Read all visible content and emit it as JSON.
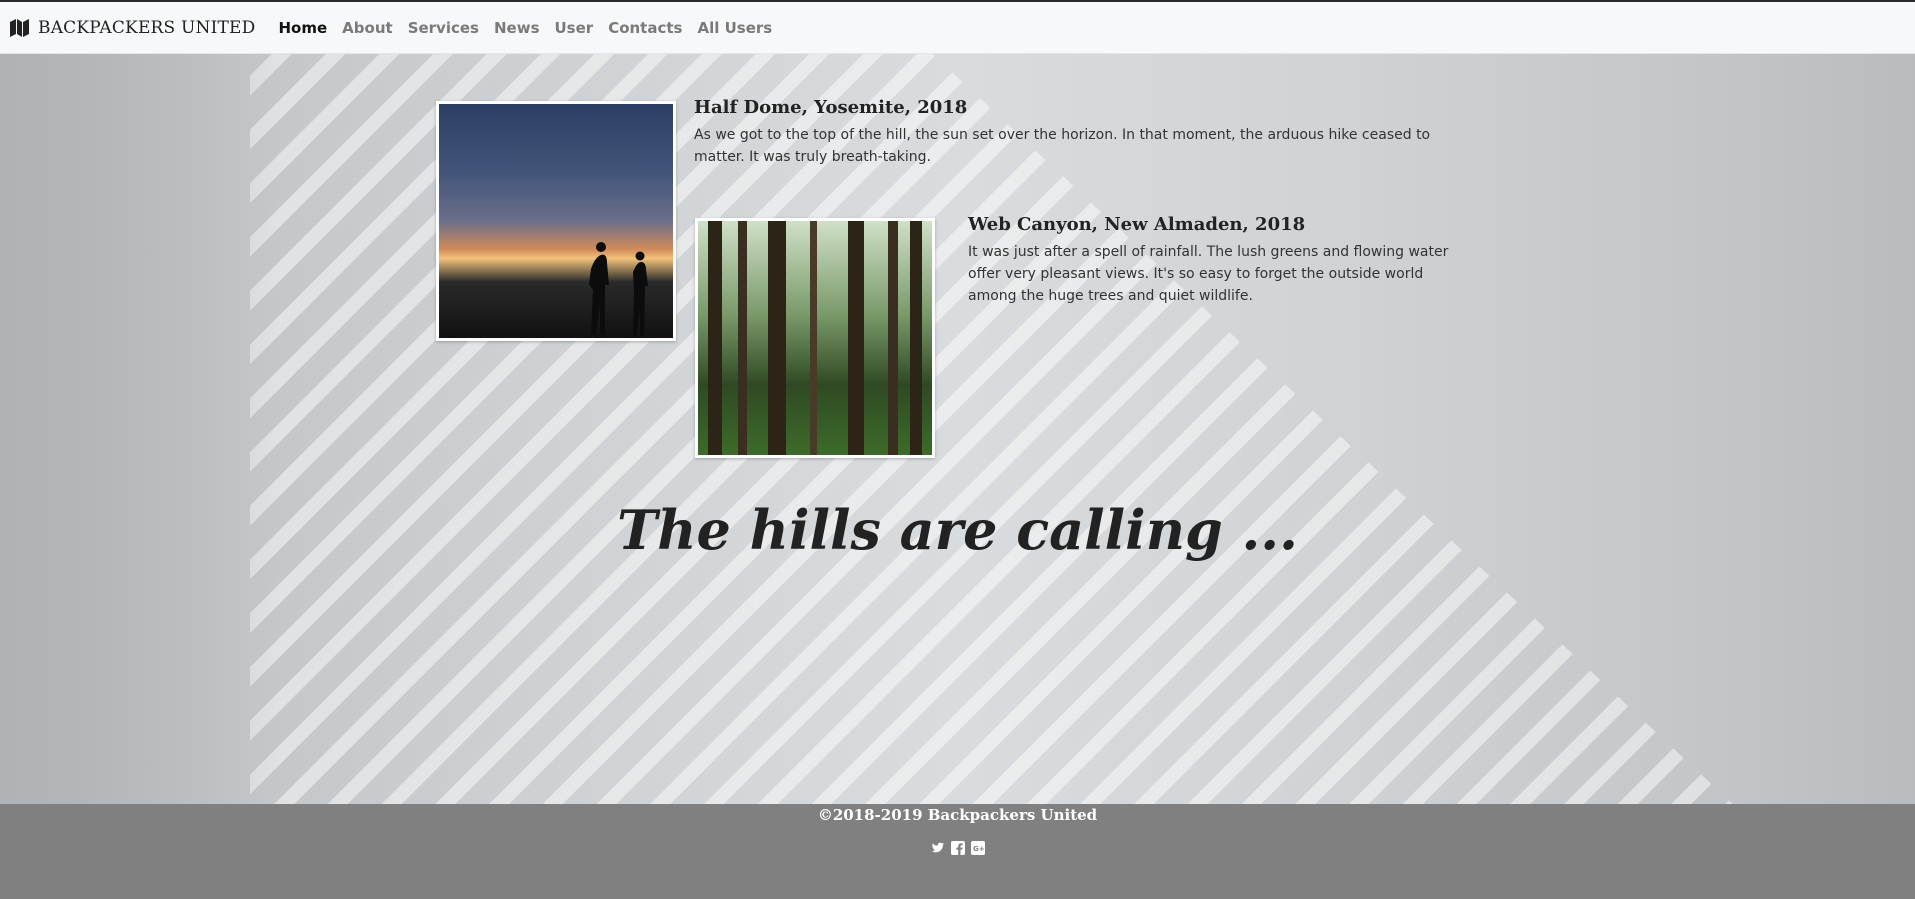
{
  "brand": {
    "name": "BACKPACKERS UNITED",
    "icon": "map-icon"
  },
  "nav": {
    "items": [
      {
        "label": "Home",
        "active": true
      },
      {
        "label": "About"
      },
      {
        "label": "Services"
      },
      {
        "label": "News"
      },
      {
        "label": "User"
      },
      {
        "label": "Contacts"
      },
      {
        "label": "All Users"
      }
    ]
  },
  "stories": [
    {
      "title": "Half Dome, Yosemite, 2018",
      "text": "As we got to the top of the hill, the sun set over the horizon. In that moment, the arduous hike ceased to matter. It was truly breath-taking."
    },
    {
      "title": "Web Canyon, New Almaden, 2018",
      "text": "It was just after a spell of rainfall. The lush greens and flowing water offer very pleasant views. It's so easy to forget the outside world among the huge trees and quiet wildlife."
    }
  ],
  "tagline": "The hills are calling ...",
  "footer": {
    "copyright": "©2018-2019 Backpackers United",
    "social": [
      "twitter-icon",
      "facebook-icon",
      "google-plus-icon"
    ]
  }
}
